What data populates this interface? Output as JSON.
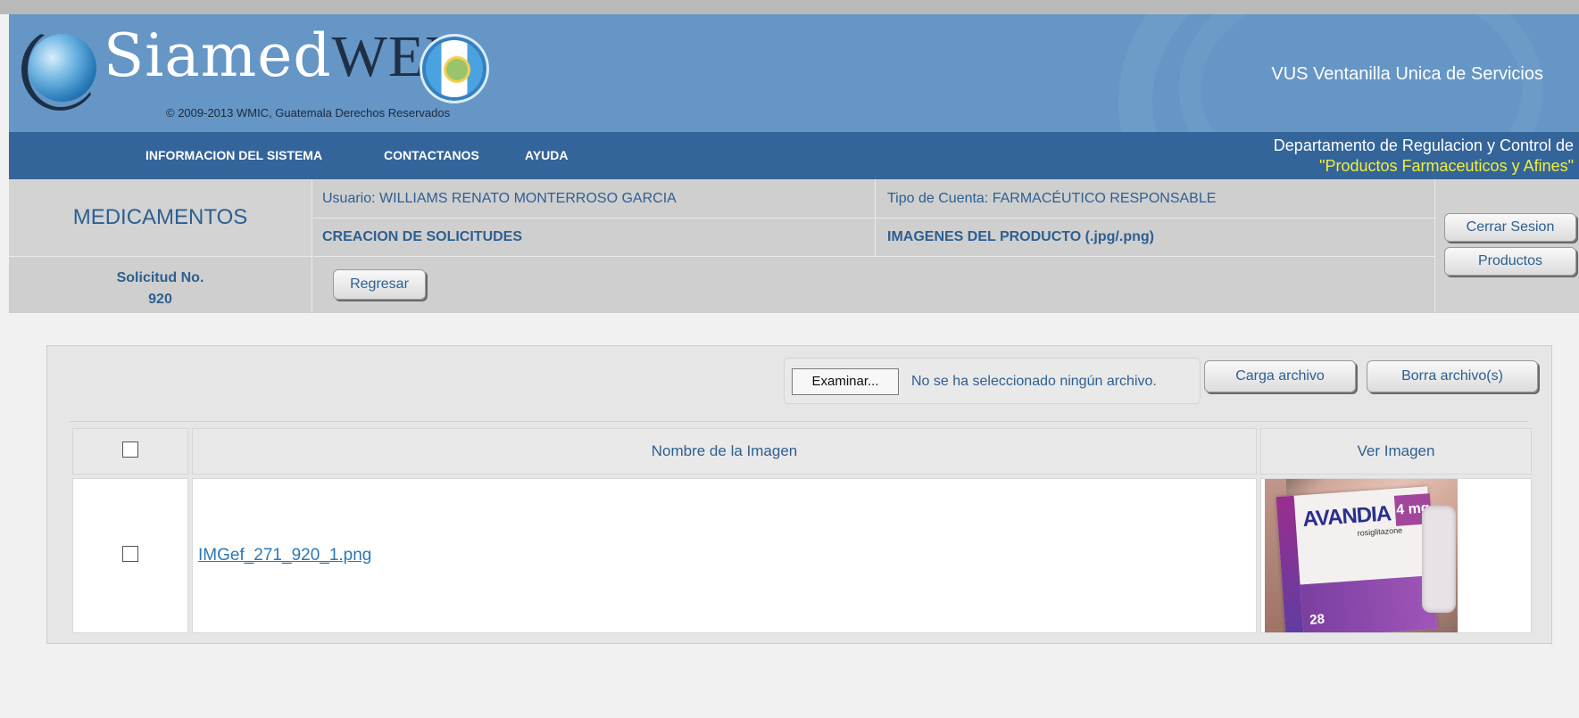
{
  "header": {
    "logo_main": "Siamed",
    "logo_accent": "WEB",
    "copyright": "© 2009-2013 WMIC, Guatemala Derechos Reservados",
    "service_title": "VUS Ventanilla Unica de Servicios"
  },
  "nav": {
    "items": [
      "INFORMACION DEL SISTEMA",
      "CONTACTANOS",
      "AYUDA"
    ],
    "department_line1": "Departamento de Regulacion y Control de",
    "department_line2": "\"Productos Farmaceuticos y Afines\""
  },
  "info": {
    "section": "MEDICAMENTOS",
    "user": "Usuario: WILLIAMS RENATO MONTERROSO GARCIA",
    "account_type": "Tipo de Cuenta: FARMACÉUTICO RESPONSABLE",
    "module": "CREACION DE SOLICITUDES",
    "subsection": "IMAGENES DEL PRODUCTO (.jpg/.png)",
    "request_label": "Solicitud No.",
    "request_number": "920",
    "back_button": "Regresar",
    "logout_button": "Cerrar Sesion",
    "products_button": "Productos"
  },
  "upload": {
    "browse_button": "Examinar...",
    "no_file_text": "No se ha seleccionado ningún archivo.",
    "upload_button": "Carga archivo",
    "delete_button": "Borra archivo(s)"
  },
  "table": {
    "col_name": "Nombre de la Imagen",
    "col_view": "Ver Imagen",
    "rows": [
      {
        "filename": "IMGef_271_920_1.png",
        "checked": false
      }
    ]
  },
  "thumbnail": {
    "brand": "AVANDIA",
    "dose": "4 mg",
    "generic": "rosiglitazone",
    "count": "28"
  },
  "colors": {
    "header_bg": "#6596c6",
    "nav_bg": "#34659a",
    "accent_text": "#2d5f91",
    "highlight": "#f1ee3b"
  }
}
